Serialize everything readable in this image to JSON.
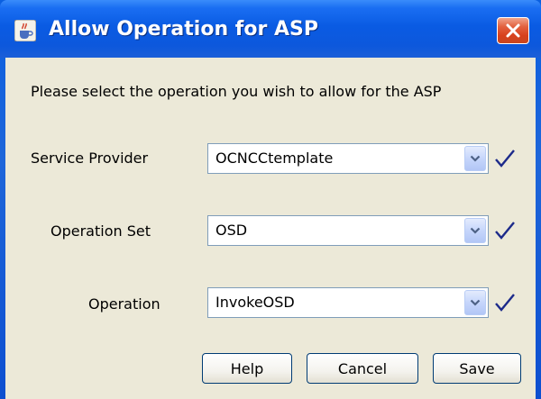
{
  "window": {
    "title": "Allow Operation for ASP",
    "icon": "java-cup-icon",
    "close_icon": "close-icon"
  },
  "dialog": {
    "prompt": "Please select the operation you wish to allow for the ASP",
    "fields": [
      {
        "label": "Service Provider",
        "value": "OCNCCtemplate",
        "valid": true
      },
      {
        "label": "Operation Set",
        "value": "OSD",
        "valid": true
      },
      {
        "label": "Operation",
        "value": "InvokeOSD",
        "valid": true
      }
    ],
    "buttons": {
      "help": "Help",
      "cancel": "Cancel",
      "save": "Save"
    }
  },
  "colors": {
    "title_bar": "#0a5be3",
    "client_bg": "#ece9d8",
    "check": "#1c2a8a",
    "close_button": "#d8401c"
  }
}
